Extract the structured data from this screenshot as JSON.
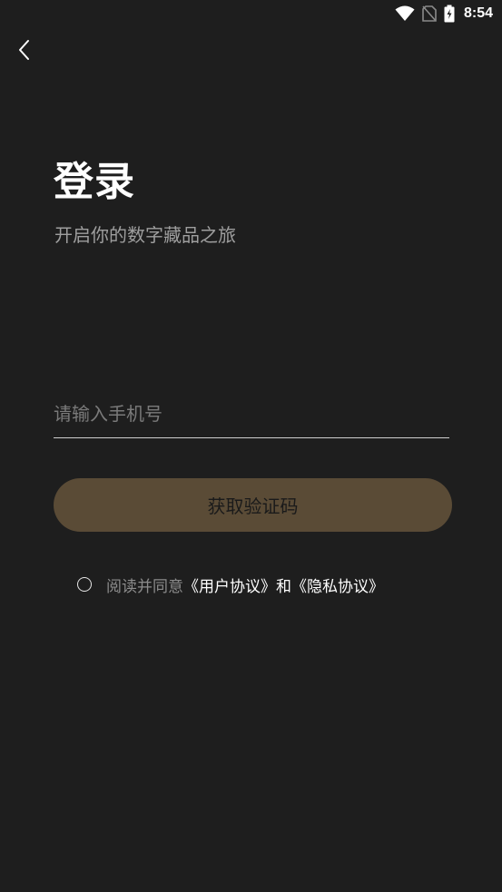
{
  "status_bar": {
    "time": "8:54",
    "icons": [
      "wifi-icon",
      "no-sim-icon",
      "battery-charging-icon"
    ]
  },
  "header": {
    "back_icon": "chevron-left-icon"
  },
  "page": {
    "title": "登录",
    "subtitle": "开启你的数字藏品之旅"
  },
  "form": {
    "phone_placeholder": "请输入手机号",
    "phone_value": "",
    "get_code_label": "获取验证码"
  },
  "agreement": {
    "prefix": "阅读并同意",
    "user_agreement": "《用户协议》",
    "conjunction": "和",
    "privacy_policy": "《隐私协议》",
    "checked": false
  },
  "colors": {
    "background": "#1e1e1e",
    "button_bg": "#5a4b36",
    "subtitle": "#9e9e9e",
    "muted_text": "#8c8c8c"
  }
}
